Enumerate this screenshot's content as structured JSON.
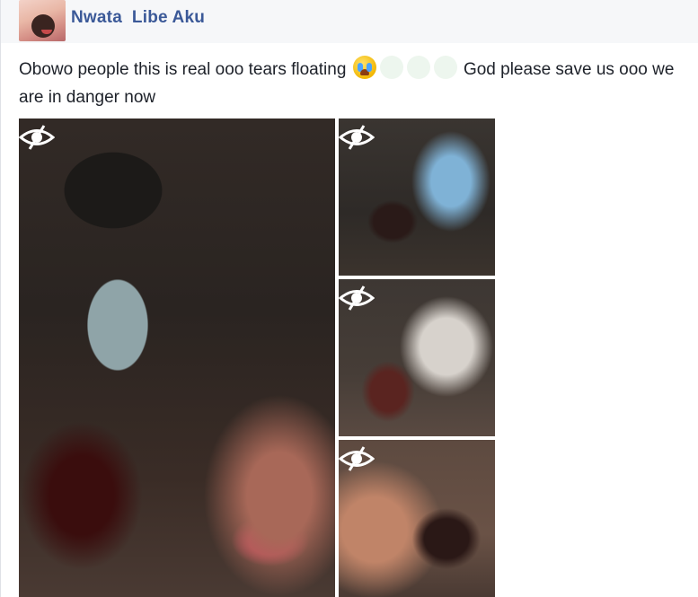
{
  "post": {
    "author": "Nwata  Libe Aku",
    "text_before_emoji": "Obowo people this is real ooo tears floating ",
    "text_after_emoji": " God please save us ooo we are in danger now",
    "emoji_icons": [
      "crying-face-icon",
      "blank-emoji-icon",
      "blank-emoji-icon",
      "blank-emoji-icon"
    ]
  },
  "photos": [
    {
      "icon": "hidden-eye-icon"
    },
    {
      "icon": "hidden-eye-icon"
    },
    {
      "icon": "hidden-eye-icon"
    },
    {
      "icon": "hidden-eye-icon"
    }
  ],
  "colors": {
    "author_link": "#3b5998",
    "text": "#1d2129",
    "header_background": "#f6f7f9"
  }
}
